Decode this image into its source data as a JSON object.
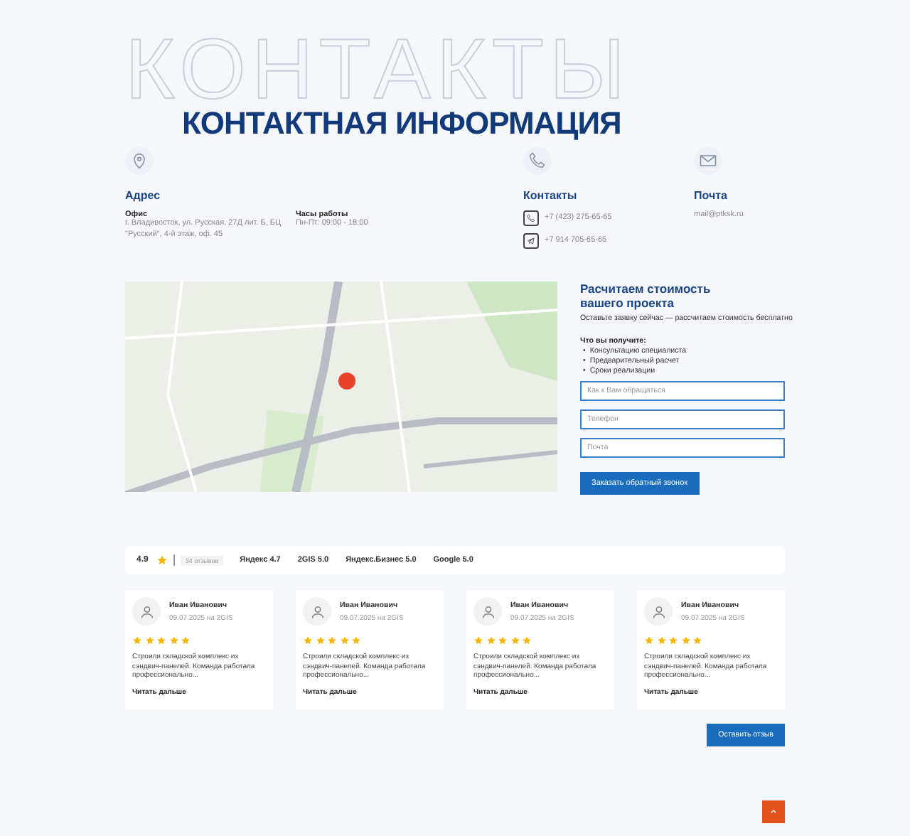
{
  "background_title": "КОНТАКТЫ",
  "heading": "КОНТАКТНАЯ ИНФОРМАЦИЯ",
  "address": {
    "title": "Адрес",
    "office_label": "Офис",
    "office_text": "г. Владивосток, ул. Русская, 27Д лит. Б, БЦ \"Русский\", 4-й этаж, оф. 45",
    "hours_label": "Часы работы",
    "hours_text": "Пн-Пт: 09:00 - 18:00"
  },
  "contacts": {
    "title": "Контакты",
    "phones": [
      {
        "kind": "phone",
        "text": "+7 (423) 275-65-65"
      },
      {
        "kind": "telegram",
        "text": "+7 914 705-65-65"
      }
    ]
  },
  "mail": {
    "title": "Почта",
    "email": "mail@ptksk.ru"
  },
  "form": {
    "title": "Расчитаем стоимость вашего проекта",
    "subtitle": "Оставьте заявку сейчас — рассчитаем стоимость бесплатно",
    "benefits_title": "Что вы получите:",
    "benefits": [
      {
        "marker": "•",
        "text": "Консультацию специалиста"
      },
      {
        "marker": "•",
        "text": "Предварительный расчет"
      },
      {
        "marker": "•",
        "text": "Сроки реализации"
      }
    ],
    "fields": [
      {
        "placeholder": "Как к Вам обращаться"
      },
      {
        "placeholder": "Телефон"
      },
      {
        "placeholder": "Почта"
      }
    ],
    "button": "Заказать обратный звонок"
  },
  "rating": {
    "score": "4.9",
    "count": "34 отзывов",
    "sources": [
      "Яндекс 4.7",
      "2GIS 5.0",
      "Яндекс.Бизнес 5.0",
      "Google 5.0"
    ]
  },
  "reviews": [
    {
      "name": "Иван Иванович",
      "date": "09.07.2025 на 2GIS",
      "stars": 5,
      "text": "Строили складской комплекс из сэндвич-панелей. Команда работала профессионально...",
      "more": "Читать дальше"
    },
    {
      "name": "Иван Иванович",
      "date": "09.07.2025 на 2GIS",
      "stars": 5,
      "text": "Строили складской комплекс из сэндвич-панелей. Команда работала профессионально...",
      "more": "Читать дальше"
    },
    {
      "name": "Иван Иванович",
      "date": "09.07.2025 на 2GIS",
      "stars": 5,
      "text": "Строили складской комплекс из сэндвич-панелей. Команда работала профессионально...",
      "more": "Читать дальше"
    },
    {
      "name": "Иван Иванович",
      "date": "09.07.2025 на 2GIS",
      "stars": 5,
      "text": "Строили складской комплекс из сэндвич-панелей. Команда работала профессионально...",
      "more": "Читать дальше"
    }
  ],
  "review_button": "Оставить отзыв"
}
